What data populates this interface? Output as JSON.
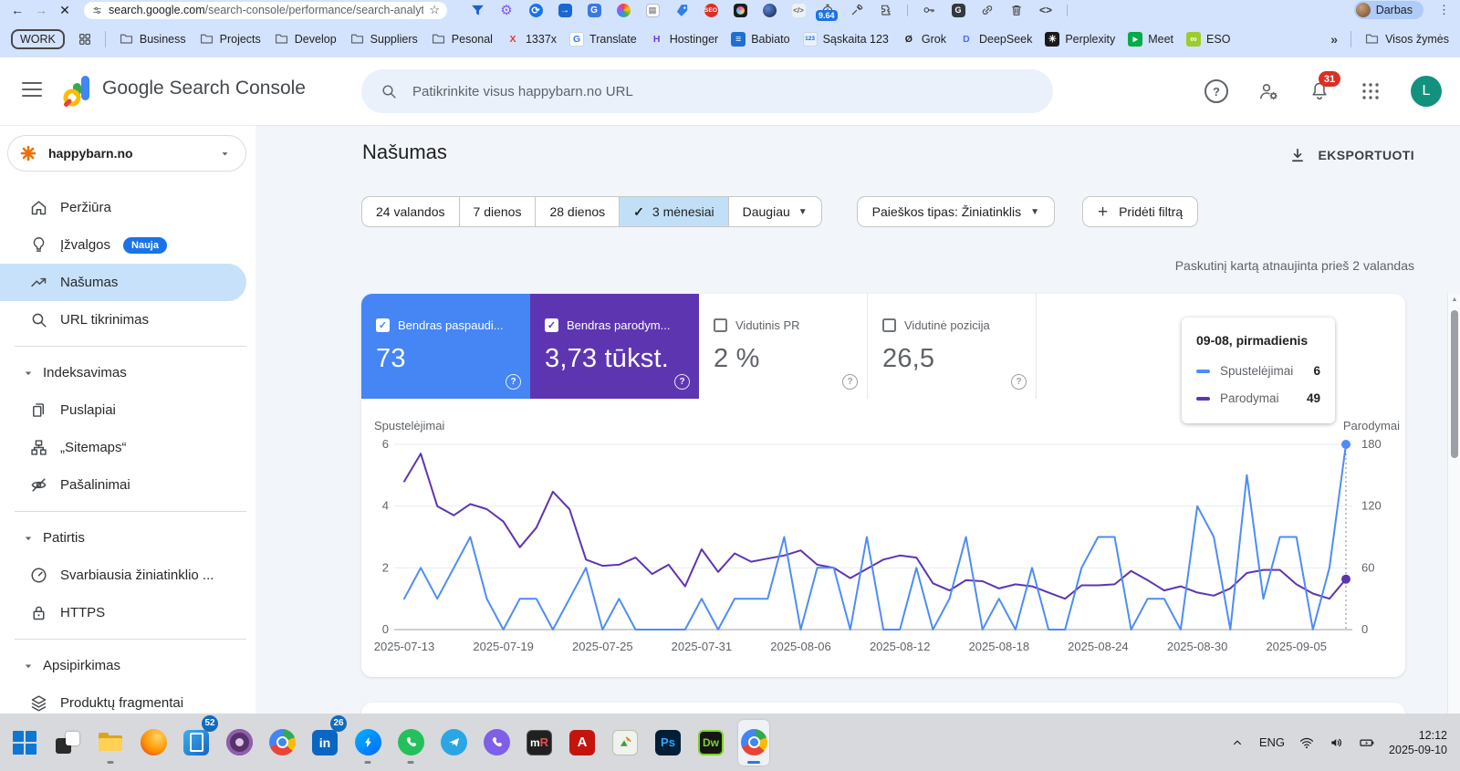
{
  "browser": {
    "url": {
      "domain": "search.google.com",
      "path": "/search-console/performance/search-analytics?res..."
    },
    "profile_label": "Darbas",
    "extensions": [
      {
        "name": "funnel-extension-icon",
        "kind": "funnel"
      },
      {
        "name": "gear-extension-icon",
        "kind": "gear"
      },
      {
        "name": "refresh-extension-icon",
        "kind": "refresh"
      },
      {
        "name": "export-extension-icon",
        "kind": "export"
      },
      {
        "name": "translate-extension-icon",
        "kind": "translate"
      },
      {
        "name": "color-wheel-extension-icon",
        "kind": "wheel"
      },
      {
        "name": "notes-extension-icon",
        "kind": "notes"
      },
      {
        "name": "tag-extension-icon",
        "kind": "tag"
      },
      {
        "name": "seo-extension-icon",
        "kind": "seo"
      },
      {
        "name": "camera-extension-icon",
        "kind": "camera"
      },
      {
        "name": "sphere-extension-icon",
        "kind": "sphere"
      },
      {
        "name": "code-extension-icon",
        "kind": "code"
      },
      {
        "name": "stopwatch-extension-icon",
        "kind": "stopwatch",
        "badge": "9.64"
      },
      {
        "name": "eyedropper-extension-icon",
        "kind": "dropper"
      },
      {
        "name": "extensions-puzzle-icon",
        "kind": "puzzle"
      },
      {
        "name": "toolbar-divider",
        "kind": "div"
      },
      {
        "name": "password-key-icon",
        "kind": "key"
      },
      {
        "name": "translate-dark-icon",
        "kind": "translate2"
      },
      {
        "name": "link-icon",
        "kind": "link"
      },
      {
        "name": "trash-icon",
        "kind": "trash"
      },
      {
        "name": "code-angle-icon",
        "kind": "code2"
      },
      {
        "name": "toolbar-divider",
        "kind": "div"
      }
    ]
  },
  "bookmarks": {
    "items": [
      {
        "kind": "group",
        "label": "WORK"
      },
      {
        "kind": "grid"
      },
      {
        "kind": "sep"
      },
      {
        "kind": "folder",
        "label": "Business"
      },
      {
        "kind": "folder",
        "label": "Projects"
      },
      {
        "kind": "folder",
        "label": "Develop"
      },
      {
        "kind": "folder",
        "label": "Suppliers"
      },
      {
        "kind": "folder",
        "label": "Pesonal"
      },
      {
        "kind": "fav",
        "label": "1337x",
        "ch": "X",
        "color": "#e53935",
        "bg": "transparent"
      },
      {
        "kind": "fav",
        "label": "Translate",
        "ch": "G",
        "color": "#3b78e7",
        "bg": "#fff",
        "border": true
      },
      {
        "kind": "fav",
        "label": "Hostinger",
        "ch": "H",
        "color": "#673de6",
        "bg": "transparent"
      },
      {
        "kind": "fav",
        "label": "Babiato",
        "ch": "≡",
        "color": "#fff",
        "bg": "#1f6fd0"
      },
      {
        "kind": "fav",
        "label": "Sąskaita 123",
        "ch": "123",
        "color": "#1967d2",
        "bg": "#e8f2ff",
        "border": true,
        "small": true
      },
      {
        "kind": "fav",
        "label": "Grok",
        "ch": "Ø",
        "color": "#202124",
        "bg": "transparent"
      },
      {
        "kind": "fav",
        "label": "DeepSeek",
        "ch": "D",
        "color": "#4d6bfe",
        "bg": "transparent"
      },
      {
        "kind": "fav",
        "label": "Perplexity",
        "ch": "✳",
        "color": "#fff",
        "bg": "#1a1a1a"
      },
      {
        "kind": "fav",
        "label": "Meet",
        "ch": "▸",
        "color": "#fff",
        "bg": "#00ac47"
      },
      {
        "kind": "fav",
        "label": "ESO",
        "ch": "∞",
        "color": "#fff",
        "bg": "#9ccc2e"
      },
      {
        "kind": "chev",
        "label": "»"
      },
      {
        "kind": "sep"
      },
      {
        "kind": "folder",
        "label": "Visos žymės"
      }
    ]
  },
  "app_header": {
    "title": "Google Search Console",
    "search_placeholder": "Patikrinkite visus happybarn.no URL",
    "notifications": "31",
    "avatar": "L"
  },
  "sidebar": {
    "property": "happybarn.no",
    "items": [
      {
        "type": "item",
        "icon": "home",
        "label": "Peržiūra"
      },
      {
        "type": "item",
        "icon": "bulb",
        "label": "Įžvalgos",
        "badge": "Nauja"
      },
      {
        "type": "item",
        "icon": "trend",
        "label": "Našumas",
        "selected": true
      },
      {
        "type": "item",
        "icon": "search",
        "label": "URL tikrinimas"
      },
      {
        "type": "divider"
      },
      {
        "type": "section",
        "label": "Indeksavimas"
      },
      {
        "type": "item",
        "icon": "pages",
        "label": "Puslapiai"
      },
      {
        "type": "item",
        "icon": "sitemap",
        "label": "„Sitemaps“"
      },
      {
        "type": "item",
        "icon": "eyeoff",
        "label": "Pašalinimai"
      },
      {
        "type": "divider"
      },
      {
        "type": "section",
        "label": "Patirtis"
      },
      {
        "type": "item",
        "icon": "gauge",
        "label": "Svarbiausia žiniatinklio ..."
      },
      {
        "type": "item",
        "icon": "lock",
        "label": "HTTPS"
      },
      {
        "type": "divider"
      },
      {
        "type": "section",
        "label": "Apsipirkimas"
      },
      {
        "type": "item",
        "icon": "tags",
        "label": "Produktų fragmentai"
      }
    ]
  },
  "main": {
    "title": "Našumas",
    "export_label": "EKSPORTUOTI",
    "date_range_tabs": [
      {
        "label": "24 valandos"
      },
      {
        "label": "7 dienos"
      },
      {
        "label": "28 dienos"
      },
      {
        "label": "3 mėnesiai",
        "selected": true
      },
      {
        "label": "Daugiau",
        "dropdown": true
      }
    ],
    "search_type_chip": "Paieškos tipas: Žiniatinklis",
    "add_filter_chip": "Pridėti filtrą",
    "last_updated": "Paskutinį kartą atnaujinta prieš 2 valandas",
    "metrics": [
      {
        "label": "Bendras paspaudi...",
        "value": "73",
        "checked": true,
        "color": "#4585f4"
      },
      {
        "label": "Bendras parodym...",
        "value": "3,73 tūkst.",
        "checked": true,
        "color": "#5e35b1"
      },
      {
        "label": "Vidutinis PR",
        "value": "2 %",
        "checked": false
      },
      {
        "label": "Vidutinė pozicija",
        "value": "26,5",
        "checked": false
      }
    ],
    "tooltip": {
      "title": "09-08, pirmadienis",
      "rows": [
        {
          "label": "Spustelėjimai",
          "value": "6",
          "color": "#4e8cf6"
        },
        {
          "label": "Parodymai",
          "value": "49",
          "color": "#5e35b1"
        }
      ]
    }
  },
  "chart_data": {
    "type": "line",
    "title": "Našumas (paspaudimai ir parodymai per 3 mėnesius)",
    "x_tick_labels": [
      "2025-07-13",
      "2025-07-19",
      "2025-07-25",
      "2025-07-31",
      "2025-08-06",
      "2025-08-12",
      "2025-08-18",
      "2025-08-24",
      "2025-08-30",
      "2025-09-05"
    ],
    "x_tick_indices": [
      0,
      6,
      12,
      18,
      24,
      30,
      36,
      42,
      48,
      54
    ],
    "left_axis": {
      "label": "Spustelėjimai",
      "ticks": [
        0,
        2,
        4,
        6
      ],
      "max": 6
    },
    "right_axis": {
      "label": "Parodymai",
      "ticks": [
        0,
        60,
        120,
        180
      ],
      "max": 180
    },
    "grid": true,
    "series": [
      {
        "name": "Spustelėjimai",
        "axis": "left",
        "color": "#4e8cf6",
        "values": [
          1,
          2,
          1,
          2,
          3,
          1,
          0,
          1,
          1,
          0,
          1,
          2,
          0,
          1,
          0,
          0,
          0,
          0,
          1,
          0,
          1,
          1,
          1,
          3,
          0,
          2,
          2,
          0,
          3,
          0,
          0,
          2,
          0,
          1,
          3,
          0,
          1,
          0,
          2,
          0,
          0,
          2,
          3,
          3,
          0,
          1,
          1,
          0,
          4,
          3,
          0,
          5,
          1,
          3,
          3,
          0,
          2,
          6
        ]
      },
      {
        "name": "Parodymai",
        "axis": "right",
        "color": "#5e35b1",
        "values": [
          144,
          171,
          120,
          111,
          122,
          117,
          105,
          80,
          99,
          134,
          117,
          68,
          62,
          63,
          70,
          54,
          63,
          42,
          78,
          56,
          74,
          66,
          69,
          72,
          77,
          63,
          60,
          50,
          59,
          68,
          72,
          70,
          45,
          38,
          48,
          47,
          40,
          44,
          42,
          36,
          30,
          43,
          43,
          44,
          57,
          48,
          38,
          42,
          36,
          33,
          40,
          55,
          58,
          58,
          44,
          35,
          30,
          49
        ]
      }
    ],
    "hover": {
      "index": 57,
      "date": "09-08, pirmadienis",
      "clicks": 6,
      "impressions": 49
    }
  },
  "taskbar": {
    "icons": [
      {
        "name": "start-button",
        "kind": "start"
      },
      {
        "name": "task-view-button",
        "kind": "taskview"
      },
      {
        "name": "file-explorer",
        "kind": "explorer",
        "running": true
      },
      {
        "name": "firefox",
        "kind": "firefox"
      },
      {
        "name": "phone-link",
        "kind": "phonelink",
        "badge": "52"
      },
      {
        "name": "tor-browser",
        "kind": "tor"
      },
      {
        "name": "chrome",
        "kind": "chrome"
      },
      {
        "name": "linkedin",
        "kind": "linkedin",
        "badge": "26"
      },
      {
        "name": "messenger",
        "kind": "messenger",
        "running": true
      },
      {
        "name": "whatsapp",
        "kind": "whatsapp",
        "running": true
      },
      {
        "name": "telegram",
        "kind": "telegram"
      },
      {
        "name": "viber",
        "kind": "viber"
      },
      {
        "name": "mirc",
        "kind": "mirc"
      },
      {
        "name": "acrobat",
        "kind": "acrobat"
      },
      {
        "name": "image-editor",
        "kind": "editor"
      },
      {
        "name": "photoshop",
        "kind": "ps"
      },
      {
        "name": "dreamweaver",
        "kind": "dw"
      },
      {
        "name": "chrome-active",
        "kind": "chrome",
        "active": true
      }
    ],
    "tray": {
      "lang": "ENG",
      "time": "12:12",
      "date": "2025-09-10"
    }
  }
}
